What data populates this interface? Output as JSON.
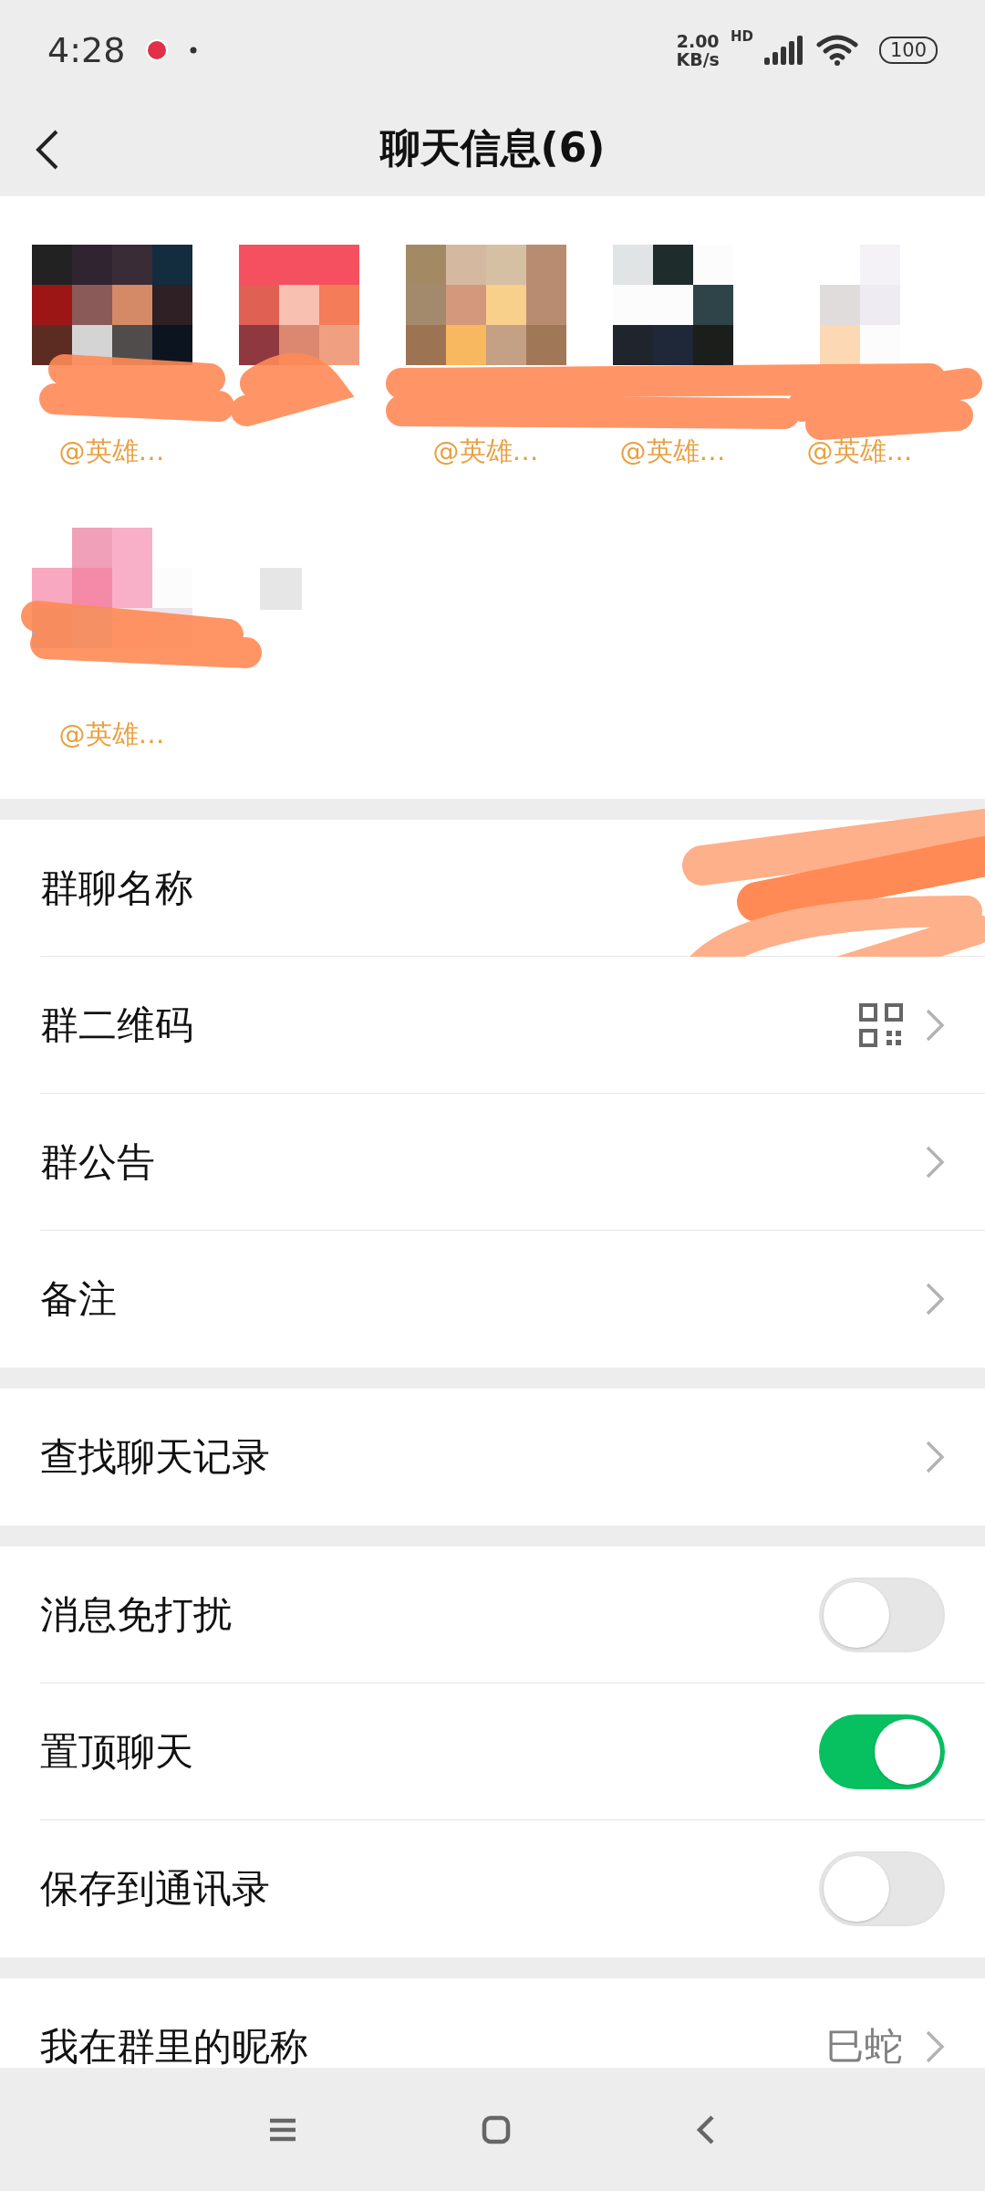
{
  "status_bar": {
    "time": "4:28",
    "speed": "2.00",
    "speed_unit": "KB/s",
    "network": "HD",
    "battery": "100"
  },
  "title": "聊天信息(6)",
  "members": [
    {
      "kind": "member",
      "tag": "@英雄…"
    },
    {
      "kind": "member"
    },
    {
      "kind": "member",
      "tag": "@英雄…"
    },
    {
      "kind": "member",
      "tag": "@英雄…"
    },
    {
      "kind": "member",
      "tag": "@英雄…"
    },
    {
      "kind": "member",
      "tag": "@英雄…"
    },
    {
      "kind": "add"
    }
  ],
  "groups": [
    [
      {
        "kind": "plain",
        "label": "群聊名称",
        "redacted": true
      },
      {
        "kind": "qr",
        "label": "群二维码"
      },
      {
        "kind": "link",
        "label": "群公告"
      },
      {
        "kind": "link",
        "label": "备注"
      }
    ],
    [
      {
        "kind": "link",
        "label": "查找聊天记录"
      }
    ],
    [
      {
        "kind": "toggle",
        "label": "消息免打扰",
        "on": false
      },
      {
        "kind": "toggle",
        "label": "置顶聊天",
        "on": true
      },
      {
        "kind": "toggle",
        "label": "保存到通讯录",
        "on": false
      }
    ],
    [
      {
        "kind": "value",
        "label": "我在群里的昵称",
        "value": "巳蛇"
      }
    ]
  ]
}
